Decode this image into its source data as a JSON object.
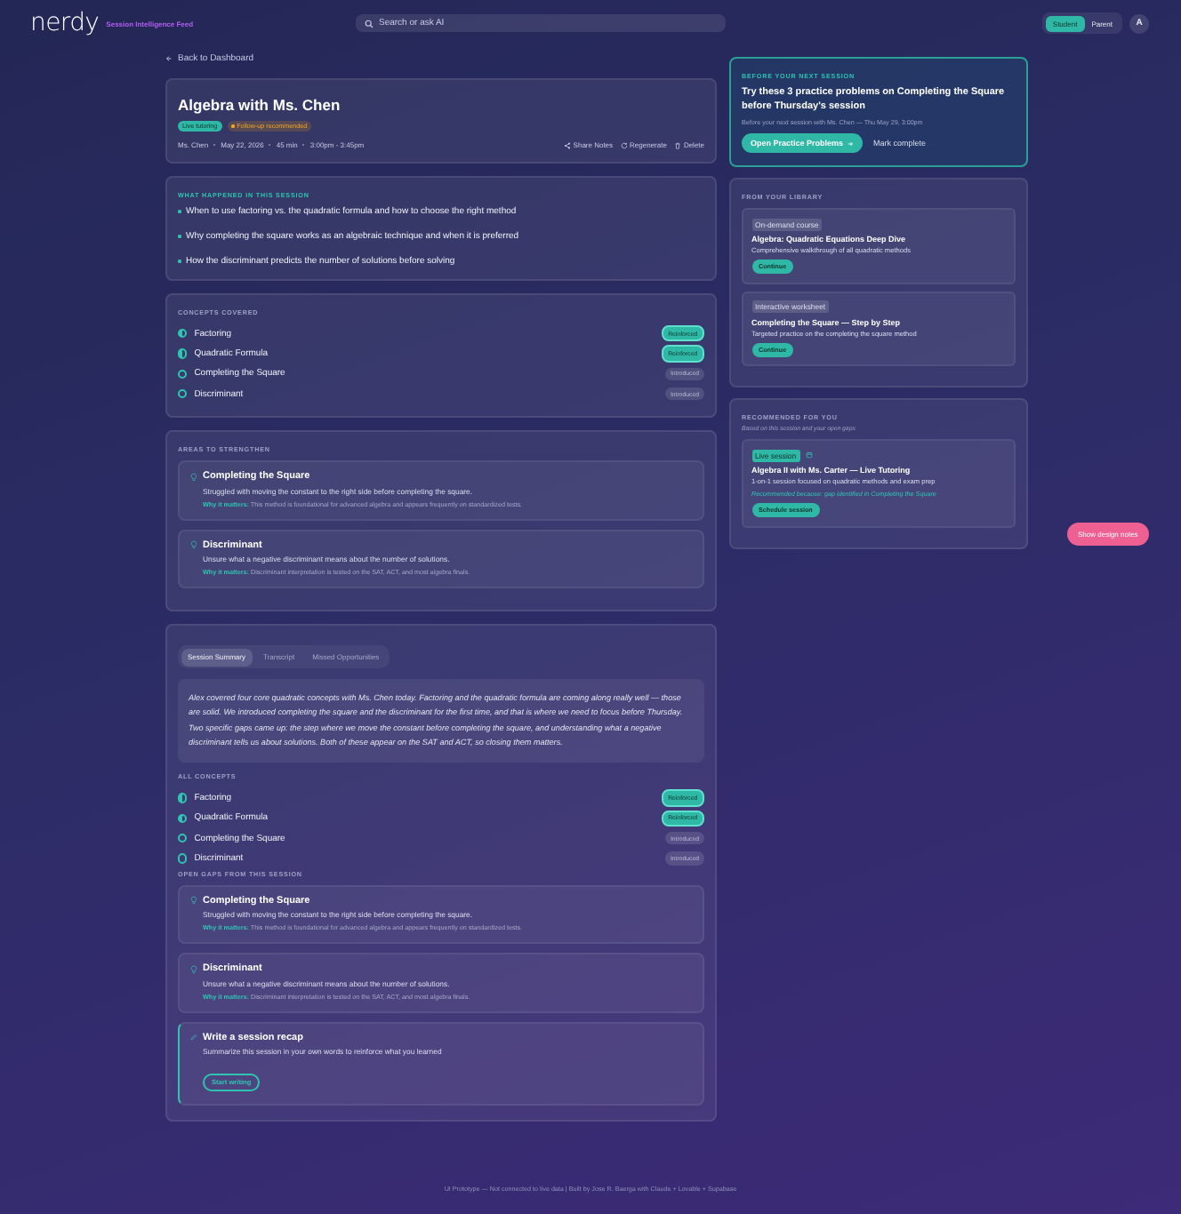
{
  "header": {
    "logo": "nerdy",
    "subtitle": "Session Intelligence Feed",
    "search": {
      "placeholder": "Search or ask AI"
    },
    "roles": [
      {
        "label": "Student",
        "selected": true
      },
      {
        "label": "Parent",
        "selected": false
      }
    ],
    "avatar": "A"
  },
  "back_link": "Back to Dashboard",
  "session": {
    "title": "Algebra with Ms. Chen",
    "tags": [
      {
        "label": "Live tutoring",
        "kind": "type"
      },
      {
        "label": "Follow-up recommended",
        "kind": "alert"
      }
    ],
    "meta": [
      "Ms. Chen",
      "May 22, 2026",
      "45 min",
      "3:00pm - 3:45pm"
    ],
    "actions": [
      {
        "label": "Share Notes",
        "kind": "share"
      },
      {
        "label": "Regenerate",
        "kind": "refresh"
      },
      {
        "label": "Delete",
        "kind": "delete"
      }
    ]
  },
  "what_happened": {
    "label": "WHAT HAPPENED IN THIS SESSION",
    "items": [
      "When to use factoring vs. the quadratic formula and how to choose the right method",
      "Why completing the square works as an algebraic technique and when it is preferred",
      "How the discriminant predicts the number of solutions before solving"
    ]
  },
  "concepts": {
    "label": "CONCEPTS COVERED",
    "items": [
      {
        "name": "Factoring",
        "status": "Reinforced",
        "kind": "reinforced"
      },
      {
        "name": "Quadratic Formula",
        "status": "Reinforced",
        "kind": "reinforced"
      },
      {
        "name": "Completing the Square",
        "status": "Introduced",
        "kind": "introduced"
      },
      {
        "name": "Discriminant",
        "status": "Introduced",
        "kind": "introduced"
      }
    ]
  },
  "strengthen": {
    "label": "AREAS TO STRENGTHEN",
    "items": [
      {
        "title": "Completing the Square",
        "description": "Struggled with moving the constant to the right side before completing the square.",
        "why_label": "Why it matters:",
        "why": "This method is foundational for advanced algebra and appears frequently on standardized tests."
      },
      {
        "title": "Discriminant",
        "description": "Unsure what a negative discriminant means about the number of solutions.",
        "why_label": "Why it matters:",
        "why": "Discriminant interpretation is tested on the SAT, ACT, and most algebra finals."
      }
    ]
  },
  "details": {
    "tabs": [
      {
        "label": "Session Summary",
        "selected": true
      },
      {
        "label": "Transcript",
        "selected": false
      },
      {
        "label": "Missed Opportunities",
        "selected": false
      }
    ],
    "summary": "Alex covered four core quadratic concepts with Ms. Chen today. Factoring and the quadratic formula are coming along really well — those are solid. We introduced completing the square and the discriminant for the first time, and that is where we need to focus before Thursday. Two specific gaps came up: the step where we move the constant before completing the square, and understanding what a negative discriminant tells us about solutions. Both of these appear on the SAT and ACT, so closing them matters.",
    "concepts_label": "ALL CONCEPTS",
    "concepts": [
      {
        "name": "Factoring",
        "status": "Reinforced",
        "kind": "reinforced"
      },
      {
        "name": "Quadratic Formula",
        "status": "Reinforced",
        "kind": "reinforced"
      },
      {
        "name": "Completing the Square",
        "status": "Introduced",
        "kind": "introduced"
      },
      {
        "name": "Discriminant",
        "status": "Introduced",
        "kind": "introduced"
      }
    ],
    "gaps_label": "OPEN GAPS FROM THIS SESSION",
    "gaps": [
      {
        "title": "Completing the Square",
        "description": "Struggled with moving the constant to the right side before completing the square.",
        "why_label": "Why it matters:",
        "why": "This method is foundational for advanced algebra and appears frequently on standardized tests."
      },
      {
        "title": "Discriminant",
        "description": "Unsure what a negative discriminant means about the number of solutions.",
        "why_label": "Why it matters:",
        "why": "Discriminant interpretation is tested on the SAT, ACT, and most algebra finals."
      }
    ],
    "recap": {
      "title": "Write a session recap",
      "description": "Summarize this session in your own words to reinforce what you learned",
      "button": "Start writing"
    }
  },
  "next_session": {
    "label": "BEFORE YOUR NEXT SESSION",
    "title": "Try these 3 practice problems on Completing the Square before Thursday's session",
    "subtitle": "Before your next session with Ms. Chen — Thu May 29, 3:00pm",
    "primary": "Open Practice Problems",
    "secondary": "Mark complete"
  },
  "library": {
    "label": "FROM YOUR LIBRARY",
    "items": [
      {
        "tag": "On-demand course",
        "title": "Algebra: Quadratic Equations Deep Dive",
        "description": "Comprehensive walkthrough of all quadratic methods",
        "button": "Continue"
      },
      {
        "tag": "Interactive worksheet",
        "title": "Completing the Square — Step by Step",
        "description": "Targeted practice on the completing the square method",
        "button": "Continue"
      }
    ]
  },
  "recommended": {
    "label": "RECOMMENDED FOR YOU",
    "subtitle": "Based on this session and your open gaps",
    "items": [
      {
        "tag": "Live session",
        "title": "Algebra II with Ms. Carter — Live Tutoring",
        "description": "1-on-1 session focused on quadratic methods and exam prep",
        "reason": "Recommended because: gap identified in Completing the Square",
        "button": "Schedule session"
      }
    ]
  },
  "design_notes_button": "Show design notes",
  "footer": "UI Prototype — Not connected to live data | Built by Jose R. Baerga with Claude + Lovable + Supabase"
}
